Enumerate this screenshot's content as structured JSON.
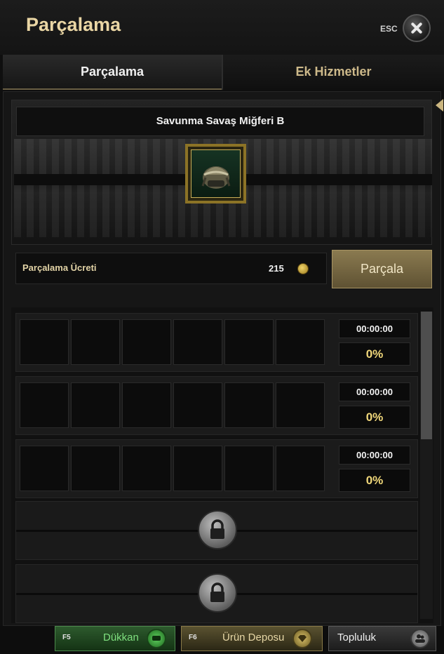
{
  "window": {
    "title": "Parçalama",
    "esc_label": "ESC"
  },
  "tabs": [
    {
      "label": "Parçalama",
      "active": true
    },
    {
      "label": "Ek Hizmetler",
      "active": false
    }
  ],
  "item": {
    "name": "Savunma Savaş Miğferi B",
    "icon": "helmet-icon"
  },
  "fee": {
    "label": "Parçalama Ücreti",
    "value": "215",
    "currency_icon": "gold-coin-icon"
  },
  "actions": {
    "dismantle_label": "Parçala"
  },
  "queue": {
    "rows": [
      {
        "time": "00:00:00",
        "progress": "0%"
      },
      {
        "time": "00:00:00",
        "progress": "0%"
      },
      {
        "time": "00:00:00",
        "progress": "0%"
      }
    ],
    "locked_rows": 2
  },
  "bottom_bar": {
    "shop": {
      "key": "F5",
      "label": "Dükkan"
    },
    "storage": {
      "key": "F6",
      "label": "Ürün Deposu"
    },
    "community": {
      "label": "Topluluk"
    }
  },
  "colors": {
    "accent_gold": "#ead6a4",
    "progress_text": "#f0d77a",
    "shop_green": "#2d5a2d"
  }
}
